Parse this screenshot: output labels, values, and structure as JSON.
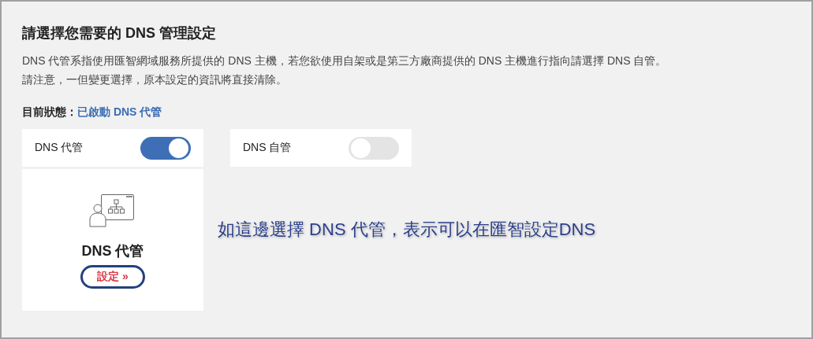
{
  "heading": "請選擇您需要的 DNS 管理設定",
  "description": [
    "DNS 代管系指使用匯智網域服務所提供的 DNS 主機，若您欲使用自架或是第三方廠商提供的 DNS 主機進行指向請選擇 DNS 自管。",
    "請注意，一但變更選擇，原本設定的資訊將直接清除。"
  ],
  "status": {
    "label": "目前狀態：",
    "value": "已啟動 DNS 代管"
  },
  "options": [
    {
      "label": "DNS 代管",
      "on": true
    },
    {
      "label": "DNS 自管",
      "on": false
    }
  ],
  "card": {
    "title": "DNS 代管",
    "button": "設定 »"
  },
  "annotation": "如這邊選擇 DNS 代管，表示可以在匯智設定DNS"
}
